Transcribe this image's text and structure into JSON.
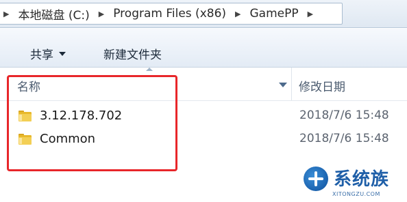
{
  "address_bar": {
    "crumbs": [
      "本地磁盘 (C:)",
      "Program Files (x86)",
      "GamePP"
    ]
  },
  "toolbar": {
    "share_label": "共享",
    "new_folder_label": "新建文件夹"
  },
  "columns": {
    "name": "名称",
    "date_modified": "修改日期"
  },
  "files": [
    {
      "name": "3.12.178.702",
      "date": "2018/7/6 15:48",
      "icon": "folder-icon"
    },
    {
      "name": "Common",
      "date": "2018/7/6 15:48",
      "icon": "folder-icon"
    }
  ],
  "highlight_color": "#e8262a",
  "watermark": {
    "brand": "系统族",
    "url": "XITONGZU.COM"
  }
}
